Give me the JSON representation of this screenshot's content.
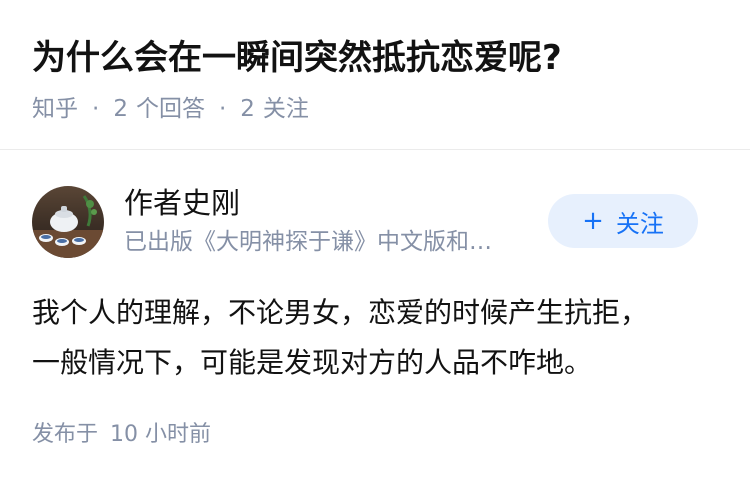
{
  "question": {
    "title": "为什么会在一瞬间突然抵抗恋爱呢?",
    "meta": {
      "source": "知乎",
      "separator": "·",
      "answers_count": "2",
      "answers_label": "个回答",
      "follows_count": "2",
      "follows_label": "关注"
    }
  },
  "answer": {
    "author": {
      "name": "作者史刚",
      "headline": "已出版《大明神探于谦》中文版和…",
      "avatar_icon": "tea-set-photo-avatar"
    },
    "follow_button": {
      "icon": "plus-icon",
      "icon_glyph": "+",
      "label": "关注"
    },
    "content": [
      "我个人的理解，不论男女，恋爱的时候产生抗拒，",
      "一般情况下，可能是发现对方的人品不咋地。"
    ],
    "publish": {
      "prefix": "发布于",
      "time": "10 小时前"
    }
  },
  "colors": {
    "title": "#121212",
    "meta": "#8590a6",
    "accent": "#1772f6",
    "follow_bg": "#e7f0fd",
    "divider": "#ebebeb"
  }
}
